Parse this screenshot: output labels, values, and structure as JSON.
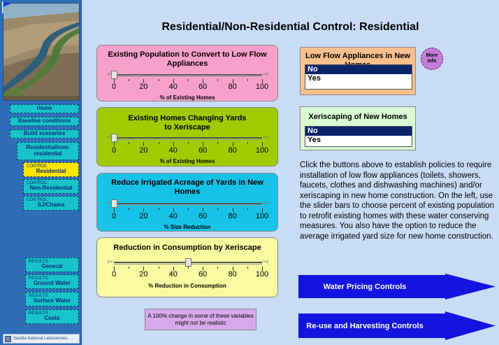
{
  "title": "Residential/Non-Residential Control: Residential",
  "nav": {
    "home": "Home",
    "baseline": "Baseline conditions",
    "build": "Build scenarios",
    "resnonres": "Residential/non-residential",
    "control_small": "CONTROL:",
    "residential": "Residential",
    "nonresidential": "Non-Residential",
    "sjchama": "SJ/Chama",
    "results_small": "RESULTS:",
    "general": "General",
    "groundwater": "Ground Water",
    "surfacewater": "Surface Water",
    "costs": "Costs",
    "logo": "Sandia National Laboratories"
  },
  "ticks": [
    "0",
    "20",
    "40",
    "60",
    "80",
    "100"
  ],
  "sliders": {
    "s1": {
      "title": "Existing Population to Convert to Low Flow Appliances",
      "units": "% of Existing Homes",
      "value": 0,
      "color": "#f7a0cc"
    },
    "s2": {
      "title": "Existing Homes Changing Yards to Xeriscape",
      "units": "% of Existing Homes",
      "value": 0,
      "color": "#9fcc00"
    },
    "s3": {
      "title": "Reduce Irrigated Acreage of Yards in New Homes",
      "units": "% Size Reduction",
      "value": 0,
      "color": "#17c3e8"
    },
    "s4": {
      "title": "Reduction in Consumption by Xeriscape",
      "units": "% Reduction in Consumption",
      "value": 50,
      "color": "#fafaa0"
    }
  },
  "lowflow": {
    "title": "Low Flow Appliances in New Homes",
    "options": [
      "No",
      "Yes"
    ],
    "selected": "No"
  },
  "xeri": {
    "title": "Xeriscaping of New Homes",
    "options": [
      "No",
      "Yes"
    ],
    "selected": "No"
  },
  "moreinfo": "More Info",
  "description": "Click the buttons above to establish policies to require installation of low flow appliances (toilets, showers, faucets, clothes and dishwashing machines) and/or xeriscaping in new home construction. On the left, use the slider bars to choose percent of existing population to retrofit existing homes with these water conserving measures. You also have the option to reduce the average irrigated yard size for new home construction.",
  "buttons": {
    "pricing": "Water Pricing Controls",
    "reuse": "Re-use and Harvesting Controls"
  },
  "warning": "A 100% change in some of these variables might not be realistic",
  "colors": {
    "sidebar": "#2f6db7",
    "navbtn": "#18c3c9",
    "active": "#ffe600",
    "arrow": "#1414e0",
    "listsel": "#0a246a",
    "lowflowpanel": "#f9c08e",
    "xeripanel": "#d9fbd4"
  }
}
